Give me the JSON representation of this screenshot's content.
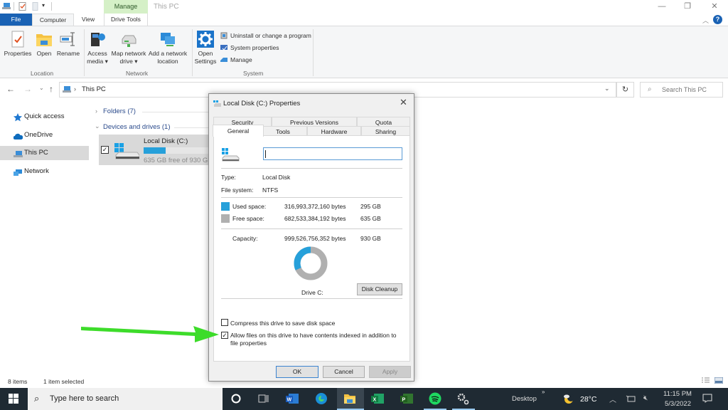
{
  "window": {
    "title": "This PC",
    "controls": {
      "minimize": "—",
      "restore": "❐",
      "close": "✕"
    }
  },
  "ribbon": {
    "contextual_tab": "Manage",
    "tabs": [
      {
        "label": "File",
        "active": false
      },
      {
        "label": "Computer",
        "active": true
      },
      {
        "label": "View",
        "active": false
      },
      {
        "label": "Drive Tools",
        "active": false
      }
    ],
    "groups": {
      "location": {
        "label": "Location",
        "buttons": [
          {
            "label": "Properties",
            "icon": "properties-icon"
          },
          {
            "label": "Open",
            "icon": "folder-open-icon"
          },
          {
            "label": "Rename",
            "icon": "rename-icon"
          }
        ]
      },
      "network": {
        "label": "Network",
        "buttons": [
          {
            "label": "Access",
            "label2": "media ▾",
            "icon": "media-icon"
          },
          {
            "label": "Map network",
            "label2": "drive ▾",
            "icon": "network-drive-icon"
          },
          {
            "label": "Add a network",
            "label2": "location",
            "icon": "network-location-icon"
          }
        ]
      },
      "system": {
        "label": "System",
        "open_settings": {
          "label": "Open",
          "label2": "Settings"
        },
        "items": [
          {
            "label": "Uninstall or change a program",
            "icon": "uninstall-icon"
          },
          {
            "label": "System properties",
            "icon": "system-properties-icon"
          },
          {
            "label": "Manage",
            "icon": "manage-icon"
          }
        ]
      }
    },
    "help": "?"
  },
  "address_bar": {
    "path": "This PC",
    "search_placeholder": "Search This PC"
  },
  "sidebar": {
    "items": [
      {
        "label": "Quick access",
        "icon": "star-icon"
      },
      {
        "label": "OneDrive",
        "icon": "cloud-icon"
      },
      {
        "label": "This PC",
        "icon": "computer-icon",
        "selected": true
      },
      {
        "label": "Network",
        "icon": "network-icon"
      }
    ]
  },
  "main": {
    "sections": [
      {
        "label": "Folders (7)",
        "expanded": false
      },
      {
        "label": "Devices and drives (1)",
        "expanded": true
      }
    ],
    "drive": {
      "name": "Local Disk (C:)",
      "free_text": "635 GB free of 930 GB",
      "used_fraction": 0.317,
      "checked": true
    }
  },
  "status_bar": {
    "items_count": "8 items",
    "selected": "1 item selected"
  },
  "dialog": {
    "title": "Local Disk (C:) Properties",
    "tabs_row1": [
      "Security",
      "Previous Versions",
      "Quota"
    ],
    "tabs_row2": [
      "General",
      "Tools",
      "Hardware",
      "Sharing"
    ],
    "active_tab": "General",
    "name_value": "",
    "type_label": "Type:",
    "type_value": "Local Disk",
    "fs_label": "File system:",
    "fs_value": "NTFS",
    "used": {
      "label": "Used space:",
      "bytes": "316,993,372,160 bytes",
      "size": "295 GB",
      "color": "#26a0da"
    },
    "free": {
      "label": "Free space:",
      "bytes": "682,533,384,192 bytes",
      "size": "635 GB",
      "color": "#b0b0b0"
    },
    "capacity": {
      "label": "Capacity:",
      "bytes": "999,526,756,352 bytes",
      "size": "930 GB"
    },
    "used_fraction": 0.317,
    "drive_label": "Drive C:",
    "disk_cleanup": "Disk Cleanup",
    "compress": {
      "label": "Compress this drive to save disk space",
      "checked": false
    },
    "index": {
      "label": "Allow files on this drive to have contents indexed in addition to",
      "label2": "file properties",
      "checked": true
    },
    "buttons": {
      "ok": "OK",
      "cancel": "Cancel",
      "apply": "Apply"
    }
  },
  "annotation": {
    "arrow_color": "#3ddc2a"
  },
  "taskbar": {
    "search_placeholder": "Type here to search",
    "apps": [
      "cortana",
      "task-view",
      "word",
      "edge",
      "file-explorer",
      "excel",
      "project",
      "spotify",
      "settings"
    ],
    "desktop_label": "Desktop",
    "chevron": "»",
    "weather": "28°C",
    "time": "11:15 PM",
    "date": "5/3/2022"
  }
}
